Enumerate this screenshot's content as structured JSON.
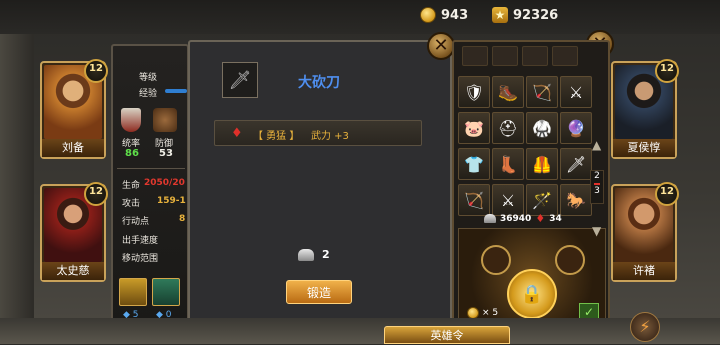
{
  "currency": {
    "gold": "943",
    "stars": "92326"
  },
  "heroes": [
    {
      "name": "刘备",
      "level": "12"
    },
    {
      "name": "太史慈",
      "level": "12"
    },
    {
      "name": "夏侯惇",
      "level": "12"
    },
    {
      "name": "许褚",
      "level": "12"
    }
  ],
  "stats": {
    "level_label": "等级",
    "exp_label": "经验",
    "command_label": "统率",
    "command_value": "86",
    "defense_label": "防御",
    "defense_value": "53",
    "hp_label": "生命",
    "hp_value": "2050/20",
    "attack_label": "攻击",
    "attack_value": "159-1",
    "action_label": "行动点",
    "action_value": "8",
    "speed_label": "出手速度",
    "range_label": "移动范围",
    "skill1_value": "5",
    "skill2_value": "0"
  },
  "forge": {
    "item_name": "大砍刀",
    "gem_text": "【 勇猛 】",
    "bonus_text": "武力 +3",
    "material_count": "2",
    "forge_button": "锻造"
  },
  "inventory": {
    "silver": "36940",
    "gems": "34",
    "page_current": "2",
    "page_total": "3",
    "token_count": "× 5",
    "bottom_tab": "英雄令"
  },
  "colors": {
    "gold_accent": "#e8b23c",
    "item_title": "#4f8ff0",
    "green_stat": "#5fe04a"
  }
}
